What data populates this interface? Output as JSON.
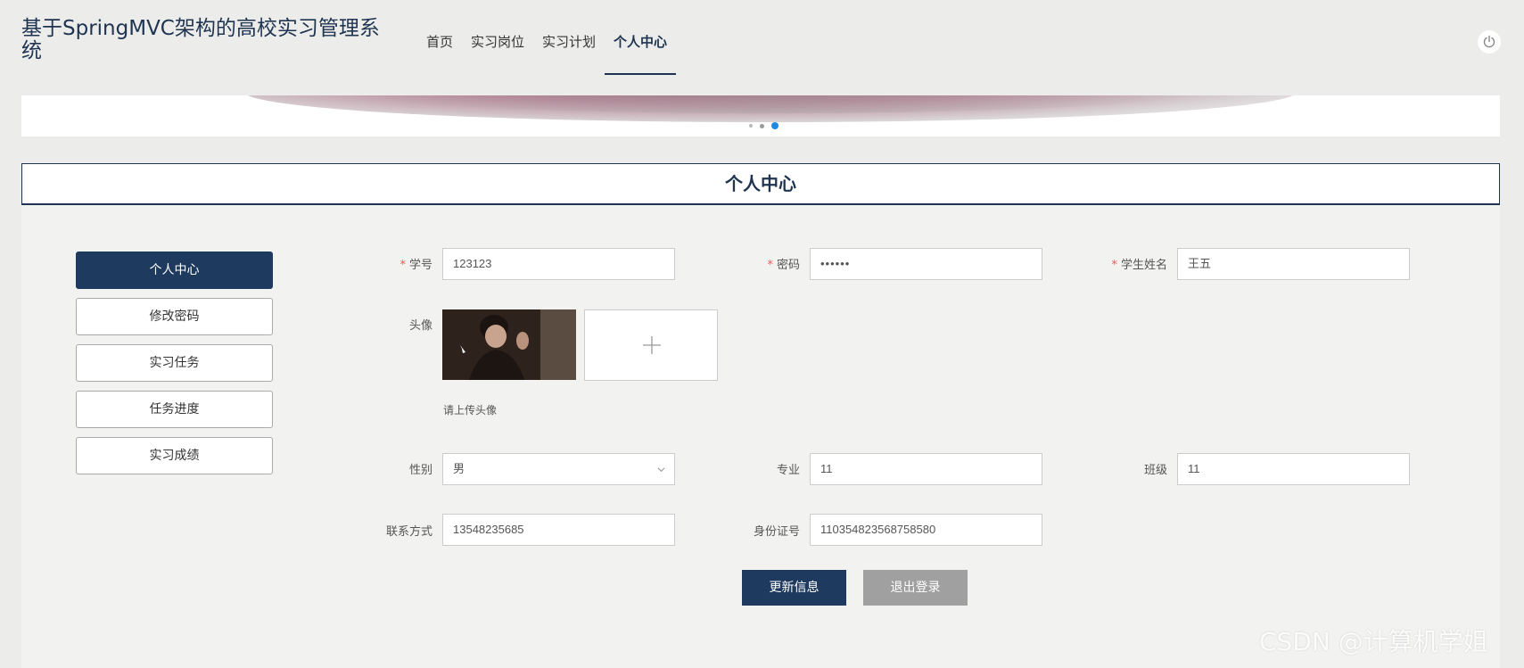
{
  "header": {
    "site_title": "基于SpringMVC架构的高校实习管理系统",
    "nav": [
      {
        "label": "首页",
        "active": false
      },
      {
        "label": "实习岗位",
        "active": false
      },
      {
        "label": "实习计划",
        "active": false
      },
      {
        "label": "个人中心",
        "active": true
      }
    ],
    "power_icon": "power-icon"
  },
  "banner": {
    "slide_count": 3,
    "active_slide": 3
  },
  "section": {
    "title": "个人中心"
  },
  "sidebar": {
    "items": [
      {
        "label": "个人中心",
        "active": true
      },
      {
        "label": "修改密码",
        "active": false
      },
      {
        "label": "实习任务",
        "active": false
      },
      {
        "label": "任务进度",
        "active": false
      },
      {
        "label": "实习成绩",
        "active": false
      }
    ]
  },
  "form": {
    "student_id": {
      "label": "学号",
      "required": true,
      "value": "123123"
    },
    "password": {
      "label": "密码",
      "required": true,
      "value": "••••••"
    },
    "student_name": {
      "label": "学生姓名",
      "required": true,
      "value": "王五"
    },
    "avatar": {
      "label": "头像",
      "hint": "请上传头像",
      "upload_icon": "plus-icon"
    },
    "gender": {
      "label": "性别",
      "value": "男"
    },
    "major": {
      "label": "专业",
      "value": "11"
    },
    "class": {
      "label": "班级",
      "value": "11"
    },
    "contact": {
      "label": "联系方式",
      "value": "13548235685"
    },
    "id_card": {
      "label": "身份证号",
      "value": "110354823568758580"
    }
  },
  "actions": {
    "update": "更新信息",
    "logout": "退出登录"
  },
  "watermark": "CSDN @计算机学姐",
  "colors": {
    "primary": "#1f3a5f",
    "secondary_button": "#a0a0a0",
    "required_mark": "#e55555",
    "active_dot": "#1e88e5"
  }
}
